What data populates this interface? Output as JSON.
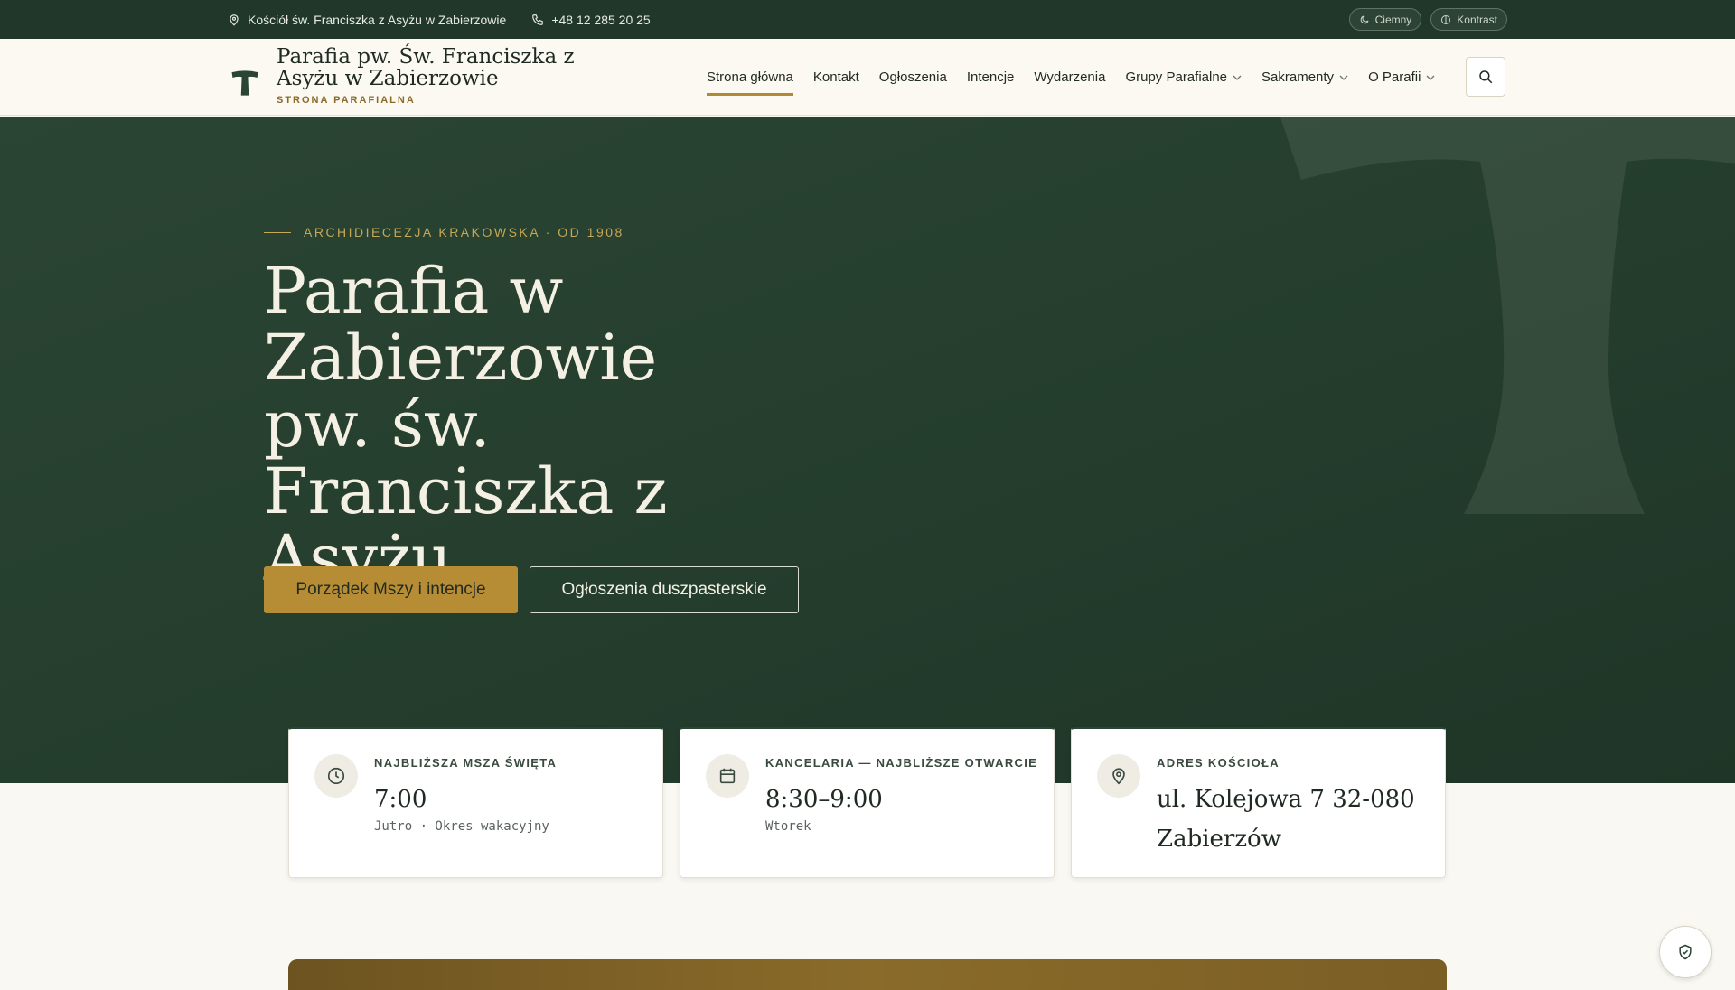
{
  "topbar": {
    "address": "Kościół św. Franciszka z Asyżu w Zabierzowie",
    "phone": "+48 12 285 20 25",
    "dark_toggle": "Ciemny",
    "contrast_toggle": "Kontrast"
  },
  "header": {
    "site_title": "Parafia pw. Św. Franciszka z Asyżu w Zabierzowie",
    "site_subtitle": "STRONA PARAFIALNA",
    "nav": [
      {
        "label": "Strona główna",
        "active": true
      },
      {
        "label": "Kontakt"
      },
      {
        "label": "Ogłoszenia"
      },
      {
        "label": "Intencje"
      },
      {
        "label": "Wydarzenia"
      },
      {
        "label": "Grupy Parafialne",
        "dropdown": true
      },
      {
        "label": "Sakramenty",
        "dropdown": true
      },
      {
        "label": "O Parafii",
        "dropdown": true
      }
    ]
  },
  "hero": {
    "eyebrow": "ARCHIDIECEZJA KRAKOWSKA · OD 1908",
    "title": "Parafia w Zabierzowie pw. św. Franciszka z Asyżu",
    "primary_button": "Porządek Mszy i intencje",
    "secondary_button": "Ogłoszenia duszpasterskie"
  },
  "cards": [
    {
      "label": "NAJBLIŻSZA MSZA ŚWIĘTA",
      "value": "7:00",
      "note": "Jutro · Okres wakacyjny",
      "icon": "clock-icon"
    },
    {
      "label": "KANCELARIA — NAJBLIŻSZE OTWARCIE",
      "value": "8:30–9:00",
      "note": "Wtorek",
      "icon": "calendar-icon"
    },
    {
      "label": "ADRES KOŚCIOŁA",
      "value": "ul. Kolejowa 7 32-080 Zabierzów",
      "icon": "map-pin-icon"
    }
  ],
  "colors": {
    "primary_green": "#21372a",
    "accent_gold": "#b68d35",
    "background": "#faf8f2"
  }
}
